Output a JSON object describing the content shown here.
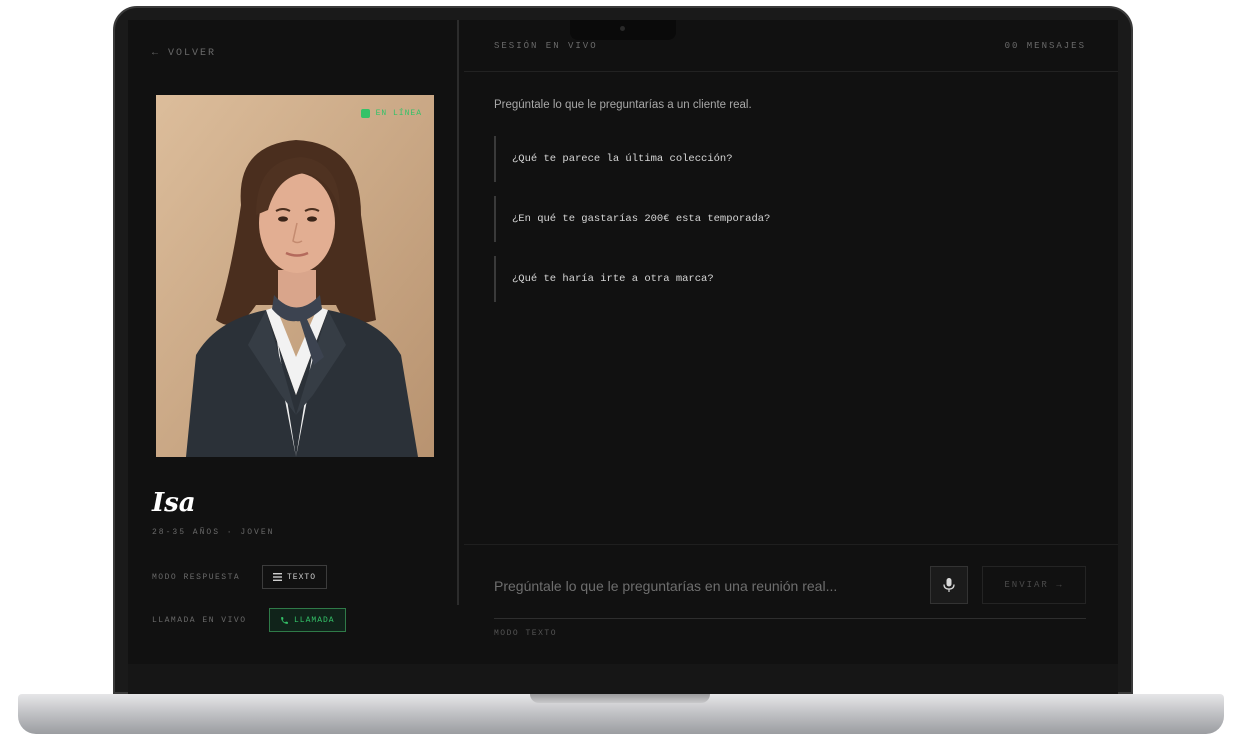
{
  "nav": {
    "back_label": "← VOLVER"
  },
  "persona": {
    "status_label": "EN LÍNEA",
    "name": "Isa",
    "meta": "28-35 AÑOS · JOVEN",
    "response_mode_label": "MODO RESPUESTA",
    "response_mode_value": "TEXTO",
    "live_call_label": "LLAMADA EN VIVO",
    "live_call_value": "LLAMADA"
  },
  "session": {
    "title": "SESIÓN EN VIVO",
    "message_count": "00 MENSAJES",
    "intro": "Pregúntale lo que le preguntarías a un cliente real.",
    "suggestions": [
      "¿Qué te parece la última colección?",
      "¿En qué te gastarías 200€ esta temporada?",
      "¿Qué te haría irte a otra marca?"
    ]
  },
  "composer": {
    "placeholder": "Pregúntale lo que le preguntarías en una reunión real...",
    "send_label": "ENVIAR →",
    "mode_label": "MODO TEXTO"
  },
  "colors": {
    "accent": "#34c268",
    "background": "#111111"
  },
  "icons": {
    "mic": "microphone-icon",
    "text": "text-lines-icon",
    "phone": "phone-icon",
    "status": "status-dot-icon"
  }
}
